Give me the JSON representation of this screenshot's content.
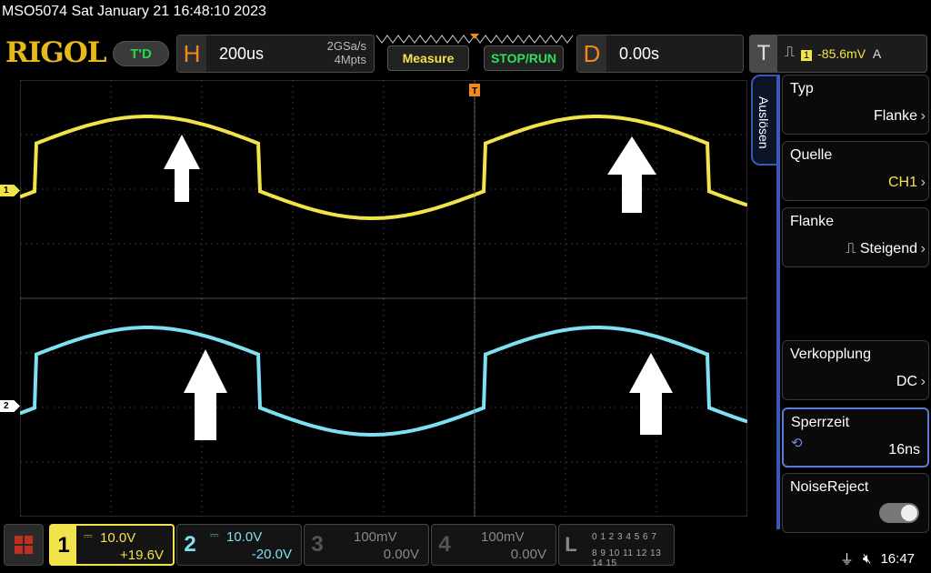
{
  "status_line": "MSO5074  Sat January 21 16:48:10 2023",
  "brand": "RIGOL",
  "mode": "T'D",
  "horizontal": {
    "tag": "H",
    "timebase": "200us",
    "sample_rate": "2GSa/s",
    "memory_depth": "4Mpts"
  },
  "buttons": {
    "measure": "Measure",
    "stop_run": "STOP/RUN"
  },
  "delay": {
    "tag": "D",
    "value": "0.00s"
  },
  "trigger": {
    "tag": "T",
    "edge_icon": "rising-edge-icon",
    "source": "1",
    "level": "-85.6mV",
    "sweep": "A"
  },
  "side_menu": {
    "tab": "Auslösen",
    "items": [
      {
        "label": "Typ",
        "value": "Flanke"
      },
      {
        "label": "Quelle",
        "value": "CH1"
      },
      {
        "label": "Flanke",
        "value": "Steigend"
      },
      {
        "label": "Verkopplung",
        "value": "DC"
      },
      {
        "label": "Sperrzeit",
        "value": "16ns"
      },
      {
        "label": "NoiseReject",
        "value": ""
      }
    ]
  },
  "channels": [
    {
      "num": "1",
      "vdiv": "10.0V",
      "offset": "+19.6V",
      "active": true,
      "color": "#f2e34a"
    },
    {
      "num": "2",
      "vdiv": "10.0V",
      "offset": "-20.0V",
      "active": true,
      "color": "#7fe0f0"
    },
    {
      "num": "3",
      "vdiv": "100mV",
      "offset": "0.00V",
      "active": false
    },
    {
      "num": "4",
      "vdiv": "100mV",
      "offset": "0.00V",
      "active": false
    }
  ],
  "la": {
    "label": "L",
    "row1": "0 1 2 3   4 5 6 7",
    "row2": "8 9 10 11  12 13 14 15"
  },
  "system": {
    "time": "16:47",
    "usb_icon": "usb-icon",
    "mute_icon": "speaker-muted-icon"
  },
  "channel_markers": [
    "1",
    "2"
  ],
  "colors": {
    "ch1": "#f2e34a",
    "ch2": "#7fe0f0",
    "accent": "#3a58b8",
    "horizontal": "#f08a1c"
  }
}
